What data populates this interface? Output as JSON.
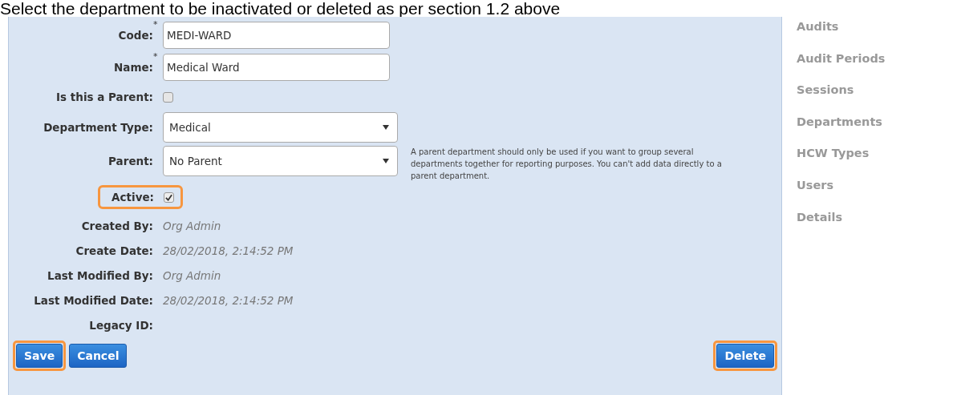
{
  "heading": "Select the department to be inactivated or deleted as per section 1.2 above",
  "form": {
    "fields": [
      {
        "kind": "text",
        "label": "Code:",
        "required_mark": "*",
        "value": "MEDI-WARD"
      },
      {
        "kind": "text",
        "label": "Name:",
        "required_mark": "*",
        "value": "Medical Ward"
      },
      {
        "kind": "checkbox",
        "label": "Is this a Parent:",
        "checked": false,
        "highlighted": false
      },
      {
        "kind": "select",
        "label": "Department Type:",
        "value": "Medical"
      },
      {
        "kind": "select",
        "label": "Parent:",
        "value": "No Parent",
        "help": "A parent department should only be used if you want to group several departments together for reporting purposes. You can't add data directly to a parent department."
      },
      {
        "kind": "checkbox",
        "label": "Active:",
        "checked": true,
        "highlighted": true
      },
      {
        "kind": "info",
        "label": "Created By:",
        "value": "Org Admin"
      },
      {
        "kind": "info",
        "label": "Create Date:",
        "value": "28/02/2018, 2:14:52 PM"
      },
      {
        "kind": "info",
        "label": "Last Modified By:",
        "value": "Org Admin"
      },
      {
        "kind": "info",
        "label": "Last Modified Date:",
        "value": "28/02/2018, 2:14:52 PM"
      },
      {
        "kind": "info",
        "label": "Legacy ID:"
      }
    ],
    "buttons": [
      {
        "label": "Save",
        "highlighted": true
      },
      {
        "label": "Cancel",
        "highlighted": false
      }
    ],
    "right_buttons": [
      {
        "label": "Delete",
        "highlighted": true
      }
    ]
  },
  "sidebar": {
    "items": [
      "Audits",
      "Audit Periods",
      "Sessions",
      "Departments",
      "HCW Types",
      "Users",
      "Details"
    ]
  }
}
